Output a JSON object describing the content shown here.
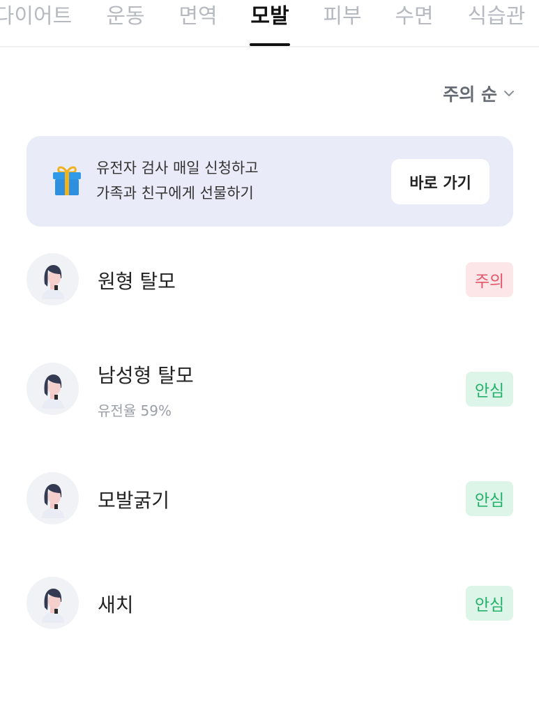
{
  "tabs": [
    {
      "label": "다이어트"
    },
    {
      "label": "운동"
    },
    {
      "label": "면역"
    },
    {
      "label": "모발"
    },
    {
      "label": "피부"
    },
    {
      "label": "수면"
    },
    {
      "label": "식습관"
    }
  ],
  "active_tab": "모발",
  "sort": {
    "label": "주의 순",
    "icon": "chevron-down-icon"
  },
  "banner": {
    "icon": "gift-icon",
    "line1": "유전자 검사 매일 신청하고",
    "line2": "가족과 친구에게 선물하기",
    "button_label": "바로 가기"
  },
  "items": [
    {
      "title": "원형 탈모",
      "subtitle": "",
      "badge": "주의",
      "status": "warn"
    },
    {
      "title": "남성형 탈모",
      "subtitle": "유전율 59%",
      "badge": "안심",
      "status": "safe"
    },
    {
      "title": "모발굵기",
      "subtitle": "",
      "badge": "안심",
      "status": "safe"
    },
    {
      "title": "새치",
      "subtitle": "",
      "badge": "안심",
      "status": "safe"
    }
  ],
  "colors": {
    "warn_bg": "#fde6e8",
    "warn_text": "#e5566a",
    "safe_bg": "#dcf5e8",
    "safe_text": "#24b26a",
    "banner_bg": "#e9ecf8"
  }
}
